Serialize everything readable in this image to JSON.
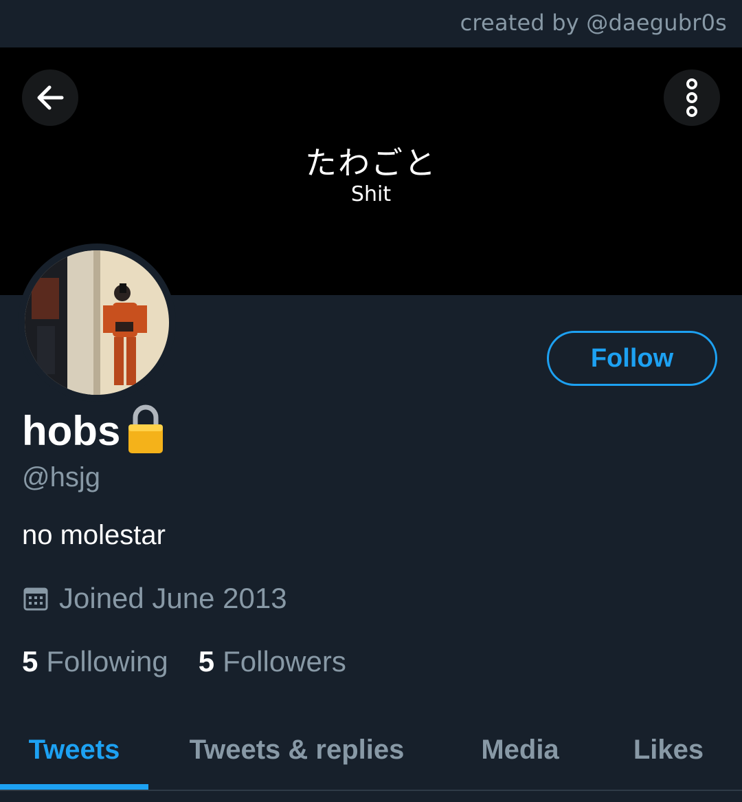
{
  "credit": "created by @daegubr0s",
  "banner": {
    "text_jp": "たわごと",
    "text_en": "Shit",
    "background": "#000000"
  },
  "toolbar": {
    "back_icon": "arrow-left-icon",
    "more_icon": "more-vertical-icon"
  },
  "profile": {
    "name": "hobs",
    "lock_icon": "padlock-icon",
    "handle": "@hsjg",
    "bio": "no molestar",
    "joined_icon": "calendar-icon",
    "joined": "Joined June 2013",
    "following_count": "5",
    "following_label": "Following",
    "followers_count": "5",
    "followers_label": "Followers",
    "follow_button": "Follow"
  },
  "tabs": [
    {
      "label": "Tweets",
      "active": true
    },
    {
      "label": "Tweets & replies",
      "active": false
    },
    {
      "label": "Media",
      "active": false
    },
    {
      "label": "Likes",
      "active": false
    }
  ],
  "colors": {
    "background": "#17202b",
    "accent": "#1da1f2",
    "secondary_text": "#8899a6",
    "primary_text": "#ffffff"
  }
}
